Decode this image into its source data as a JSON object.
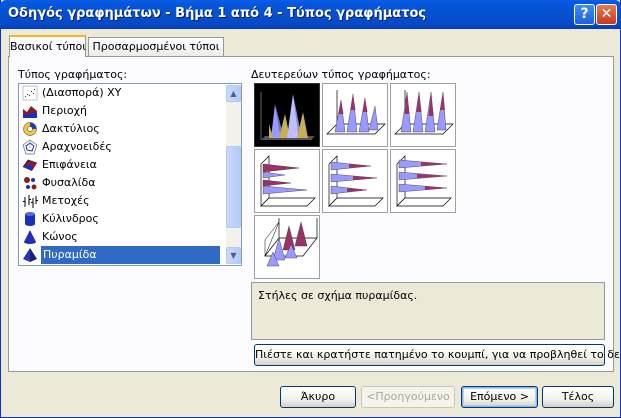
{
  "window": {
    "title": "Οδηγός γραφημάτων - Βήμα 1 από 4 - Τύπος γραφήματος"
  },
  "titlebar_buttons": {
    "help": "?",
    "close": "✕"
  },
  "tabs": [
    {
      "label": "Βασικοί τύποι",
      "active": true
    },
    {
      "label": "Προσαρμοσμένοι τύποι",
      "active": false
    }
  ],
  "chart_type_label": "Τύπος γραφήματος:",
  "chart_types": [
    {
      "label": "(Διασπορά) XY",
      "icon": "scatter-icon"
    },
    {
      "label": "Περιοχή",
      "icon": "area-icon"
    },
    {
      "label": "Δακτύλιος",
      "icon": "doughnut-icon"
    },
    {
      "label": "Αραχνοειδές",
      "icon": "radar-icon"
    },
    {
      "label": "Επιφάνεια",
      "icon": "surface-icon"
    },
    {
      "label": "Φυσαλίδα",
      "icon": "bubble-icon"
    },
    {
      "label": "Μετοχές",
      "icon": "stock-icon"
    },
    {
      "label": "Κύλινδρος",
      "icon": "cylinder-icon"
    },
    {
      "label": "Κώνος",
      "icon": "cone-icon"
    },
    {
      "label": "Πυραμίδα",
      "icon": "pyramid-icon",
      "selected": true
    }
  ],
  "subtype_label": "Δευτερεύων τύπος γραφήματος:",
  "description": "Στήλες σε σχήμα πυραμίδας.",
  "preview_button": "Πιέστε και κρατήστε πατημένο το κουμπί, για να προβληθεί το δείγμα",
  "buttons": {
    "cancel": "Άκυρο",
    "back": "<Προηγούμενο",
    "next": "Επόμενο >",
    "finish": "Τέλος"
  },
  "colors": {
    "selection": "#316ac5",
    "pyramid_purple": "#9999ff",
    "pyramid_maroon": "#993366",
    "titlebar": "#0553d2"
  }
}
